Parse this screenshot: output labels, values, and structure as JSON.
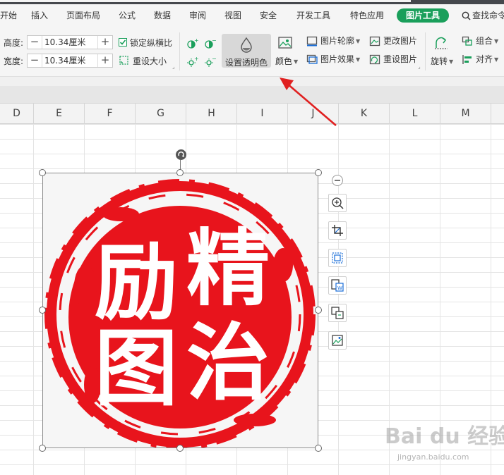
{
  "tabs": [
    "开始",
    "插入",
    "页面布局",
    "公式",
    "数据",
    "审阅",
    "视图",
    "安全",
    "开发工具",
    "特色应用"
  ],
  "active_tab": "图片工具",
  "search_tab": "查找命令",
  "size": {
    "height_label": "高度:",
    "height_value": "10.34厘米",
    "width_label": "宽度:",
    "width_value": "10.34厘米",
    "lock_ratio_label": "锁定纵横比",
    "reset_size_label": "重设大小"
  },
  "ribbon": {
    "set_transparent": "设置透明色",
    "color": "颜色",
    "picture_outline": "图片轮廓",
    "picture_effect": "图片效果",
    "change_picture": "更改图片",
    "reset_picture": "重设图片",
    "rotate": "旋转",
    "group": "组合",
    "align": "对齐"
  },
  "columns": [
    "D",
    "E",
    "F",
    "G",
    "H",
    "I",
    "J",
    "K",
    "L",
    "M"
  ],
  "seal": {
    "chars": [
      "励",
      "精",
      "图",
      "治"
    ],
    "color": "#e8141c"
  },
  "watermark": {
    "brand": "Bai du 经验",
    "url": "jingyan.baidu.com"
  },
  "colors": {
    "accent_green": "#1a9f5b",
    "arrow_red": "#e02020"
  }
}
